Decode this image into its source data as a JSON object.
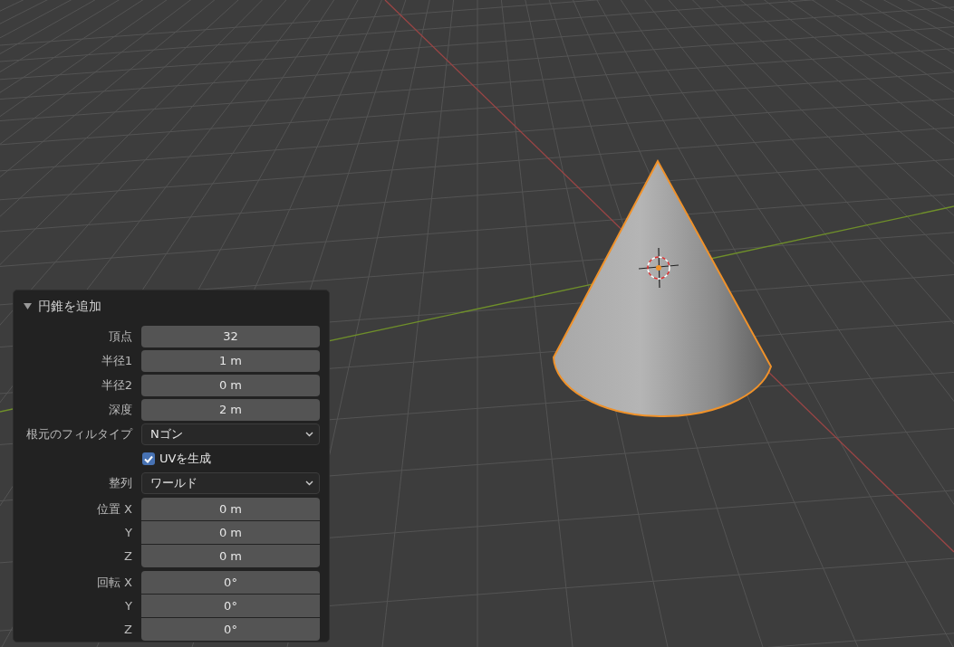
{
  "panel": {
    "title": "円錐を追加",
    "expanded": true,
    "rows": [
      {
        "kind": "number",
        "label": "頂点",
        "value": "32"
      },
      {
        "kind": "number",
        "label": "半径1",
        "value": "1 m"
      },
      {
        "kind": "number",
        "label": "半径2",
        "value": "0 m"
      },
      {
        "kind": "number",
        "label": "深度",
        "value": "2 m"
      },
      {
        "kind": "dropdown",
        "label": "根元のフィルタイプ",
        "value": "Nゴン"
      },
      {
        "kind": "checkbox",
        "label": "UVを生成",
        "checked": true
      },
      {
        "kind": "dropdown",
        "label": "整列",
        "value": "ワールド"
      }
    ],
    "vectors": [
      {
        "fields": [
          {
            "label": "位置 X",
            "value": "0 m"
          },
          {
            "label": "Y",
            "value": "0 m"
          },
          {
            "label": "Z",
            "value": "0 m"
          }
        ]
      },
      {
        "fields": [
          {
            "label": "回転 X",
            "value": "0°"
          },
          {
            "label": "Y",
            "value": "0°"
          },
          {
            "label": "Z",
            "value": "0°"
          }
        ]
      }
    ]
  }
}
